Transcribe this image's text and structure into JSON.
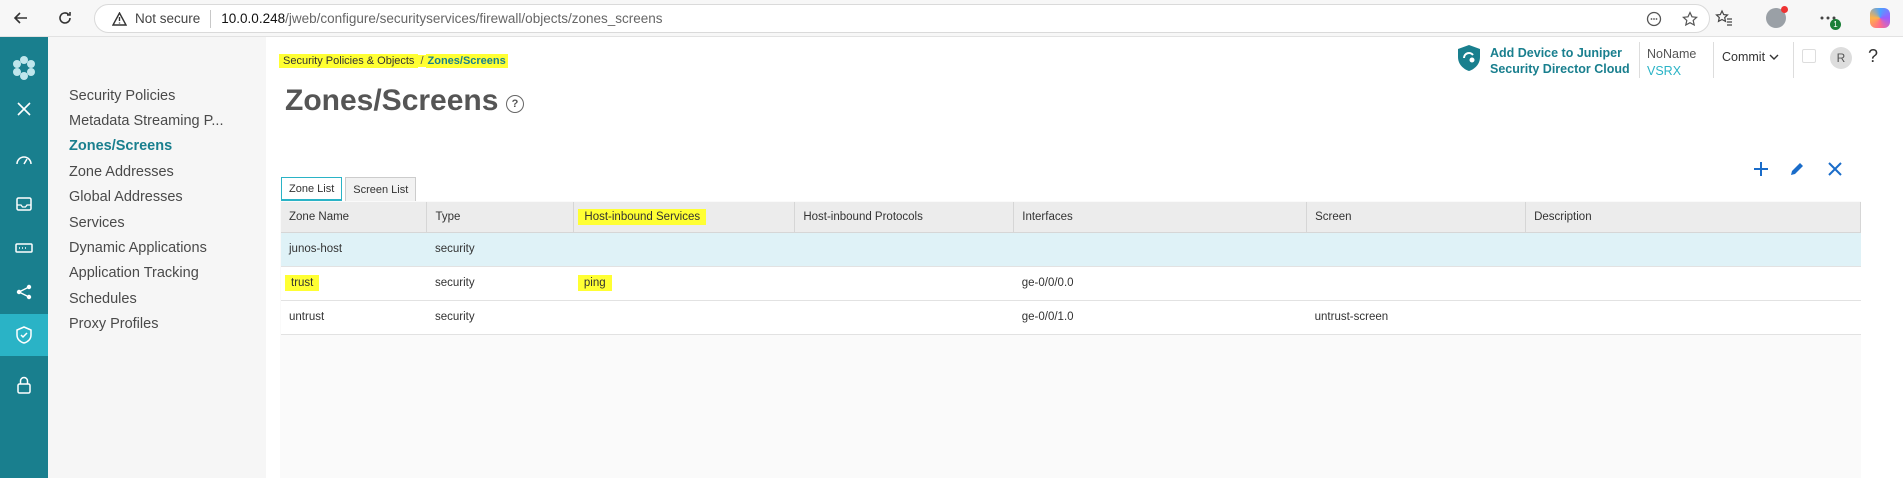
{
  "browser": {
    "not_secure": "Not secure",
    "url_host": "10.0.0.248",
    "url_path": "/jweb/configure/securityservices/firewall/objects/zones_screens",
    "extension_badge": "1"
  },
  "subnav": {
    "items": [
      {
        "label": "Security Policies"
      },
      {
        "label": "Metadata Streaming P..."
      },
      {
        "label": "Zones/Screens",
        "active": true
      },
      {
        "label": "Zone Addresses"
      },
      {
        "label": "Global Addresses"
      },
      {
        "label": "Services"
      },
      {
        "label": "Dynamic Applications"
      },
      {
        "label": "Application Tracking"
      },
      {
        "label": "Schedules"
      },
      {
        "label": "Proxy Profiles"
      }
    ]
  },
  "breadcrumb": {
    "parent": "Security Policies & Objects",
    "separator": "/",
    "current": "Zones/Screens"
  },
  "page": {
    "title": "Zones/Screens",
    "help_glyph": "?"
  },
  "header": {
    "jsdc_line1": "Add Device to Juniper",
    "jsdc_line2": "Security Director Cloud",
    "device_name": "NoName",
    "device_model": "VSRX",
    "commit_label": "Commit",
    "user_initial": "R",
    "help_glyph": "?"
  },
  "tabs": [
    {
      "label": "Zone List",
      "active": true
    },
    {
      "label": "Screen List"
    }
  ],
  "table": {
    "columns": [
      "Zone Name",
      "Type",
      "Host-inbound Services",
      "Host-inbound Protocols",
      "Interfaces",
      "Screen",
      "Description"
    ],
    "rows": [
      [
        "junos-host",
        "security",
        "",
        "",
        "",
        "",
        ""
      ],
      [
        "trust",
        "security",
        "ping",
        "",
        "ge-0/0/0.0",
        "",
        ""
      ],
      [
        "untrust",
        "security",
        "",
        "",
        "ge-0/0/1.0",
        "untrust-screen",
        ""
      ]
    ]
  },
  "colors": {
    "rail": "#197f8e",
    "rail_active": "#2ab3c6",
    "accent": "#197f8e",
    "highlight": "#ffff33",
    "action_icon": "#1a6cc9"
  },
  "icons": {
    "rail": [
      "juniper-logo-icon",
      "close-icon",
      "dashboard-icon",
      "monitor-icon",
      "device-icon",
      "network-icon",
      "security-shield-icon",
      "lock-icon"
    ],
    "actions": [
      "add-icon",
      "edit-icon",
      "delete-icon"
    ]
  }
}
